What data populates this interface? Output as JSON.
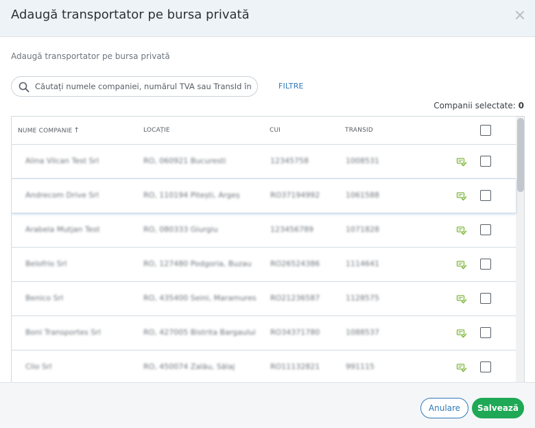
{
  "modal": {
    "title": "Adaugă transportator pe bursa privată",
    "subtitle": "Adaugă transportator pe bursa privată"
  },
  "search": {
    "placeholder": "Căutați numele companiei, numărul TVA sau TransId în b...",
    "value": ""
  },
  "filters_label": "FILTRE",
  "selected": {
    "label": "Companii selectate:",
    "count": "0"
  },
  "table": {
    "columns": [
      "NUME COMPANIE",
      "LOCAȚIE",
      "CUI",
      "TRANSID"
    ],
    "sort_icon": "↑",
    "rows": [
      {
        "name": "Alina Vilcan Test Srl",
        "location": "RO, 060921 Bucuresti",
        "cui": "12345758",
        "transid": "1008531"
      },
      {
        "name": "Andrecom Drive Srl",
        "location": "RO, 110194 Pitești, Argeș",
        "cui": "RO37194992",
        "transid": "1061588"
      },
      {
        "name": "Arabela Mutjan Test",
        "location": "RO, 080333 Giurgiu",
        "cui": "123456789",
        "transid": "1071828"
      },
      {
        "name": "Belofrio Srl",
        "location": "RO, 127480 Podgoria, Buzau",
        "cui": "RO26524386",
        "transid": "1114641"
      },
      {
        "name": "Benico Srl",
        "location": "RO, 435400 Seini, Maramures",
        "cui": "RO21236587",
        "transid": "1128575"
      },
      {
        "name": "Boni Transportes Srl",
        "location": "RO, 427005 Bistrita Bargaului",
        "cui": "RO34371780",
        "transid": "1088537"
      },
      {
        "name": "Clio Srl",
        "location": "RO, 450074 Zalău, Sălaj",
        "cui": "RO11132821",
        "transid": "991115"
      }
    ]
  },
  "footer": {
    "cancel_label": "Anulare",
    "save_label": "Salvează"
  },
  "colors": {
    "accent_blue": "#2e78b7",
    "save_green": "#1fa855",
    "icon_green": "#7fb83e"
  },
  "icons": {
    "close": "close-icon",
    "search": "search-icon",
    "row_action": "verified-company-icon"
  }
}
